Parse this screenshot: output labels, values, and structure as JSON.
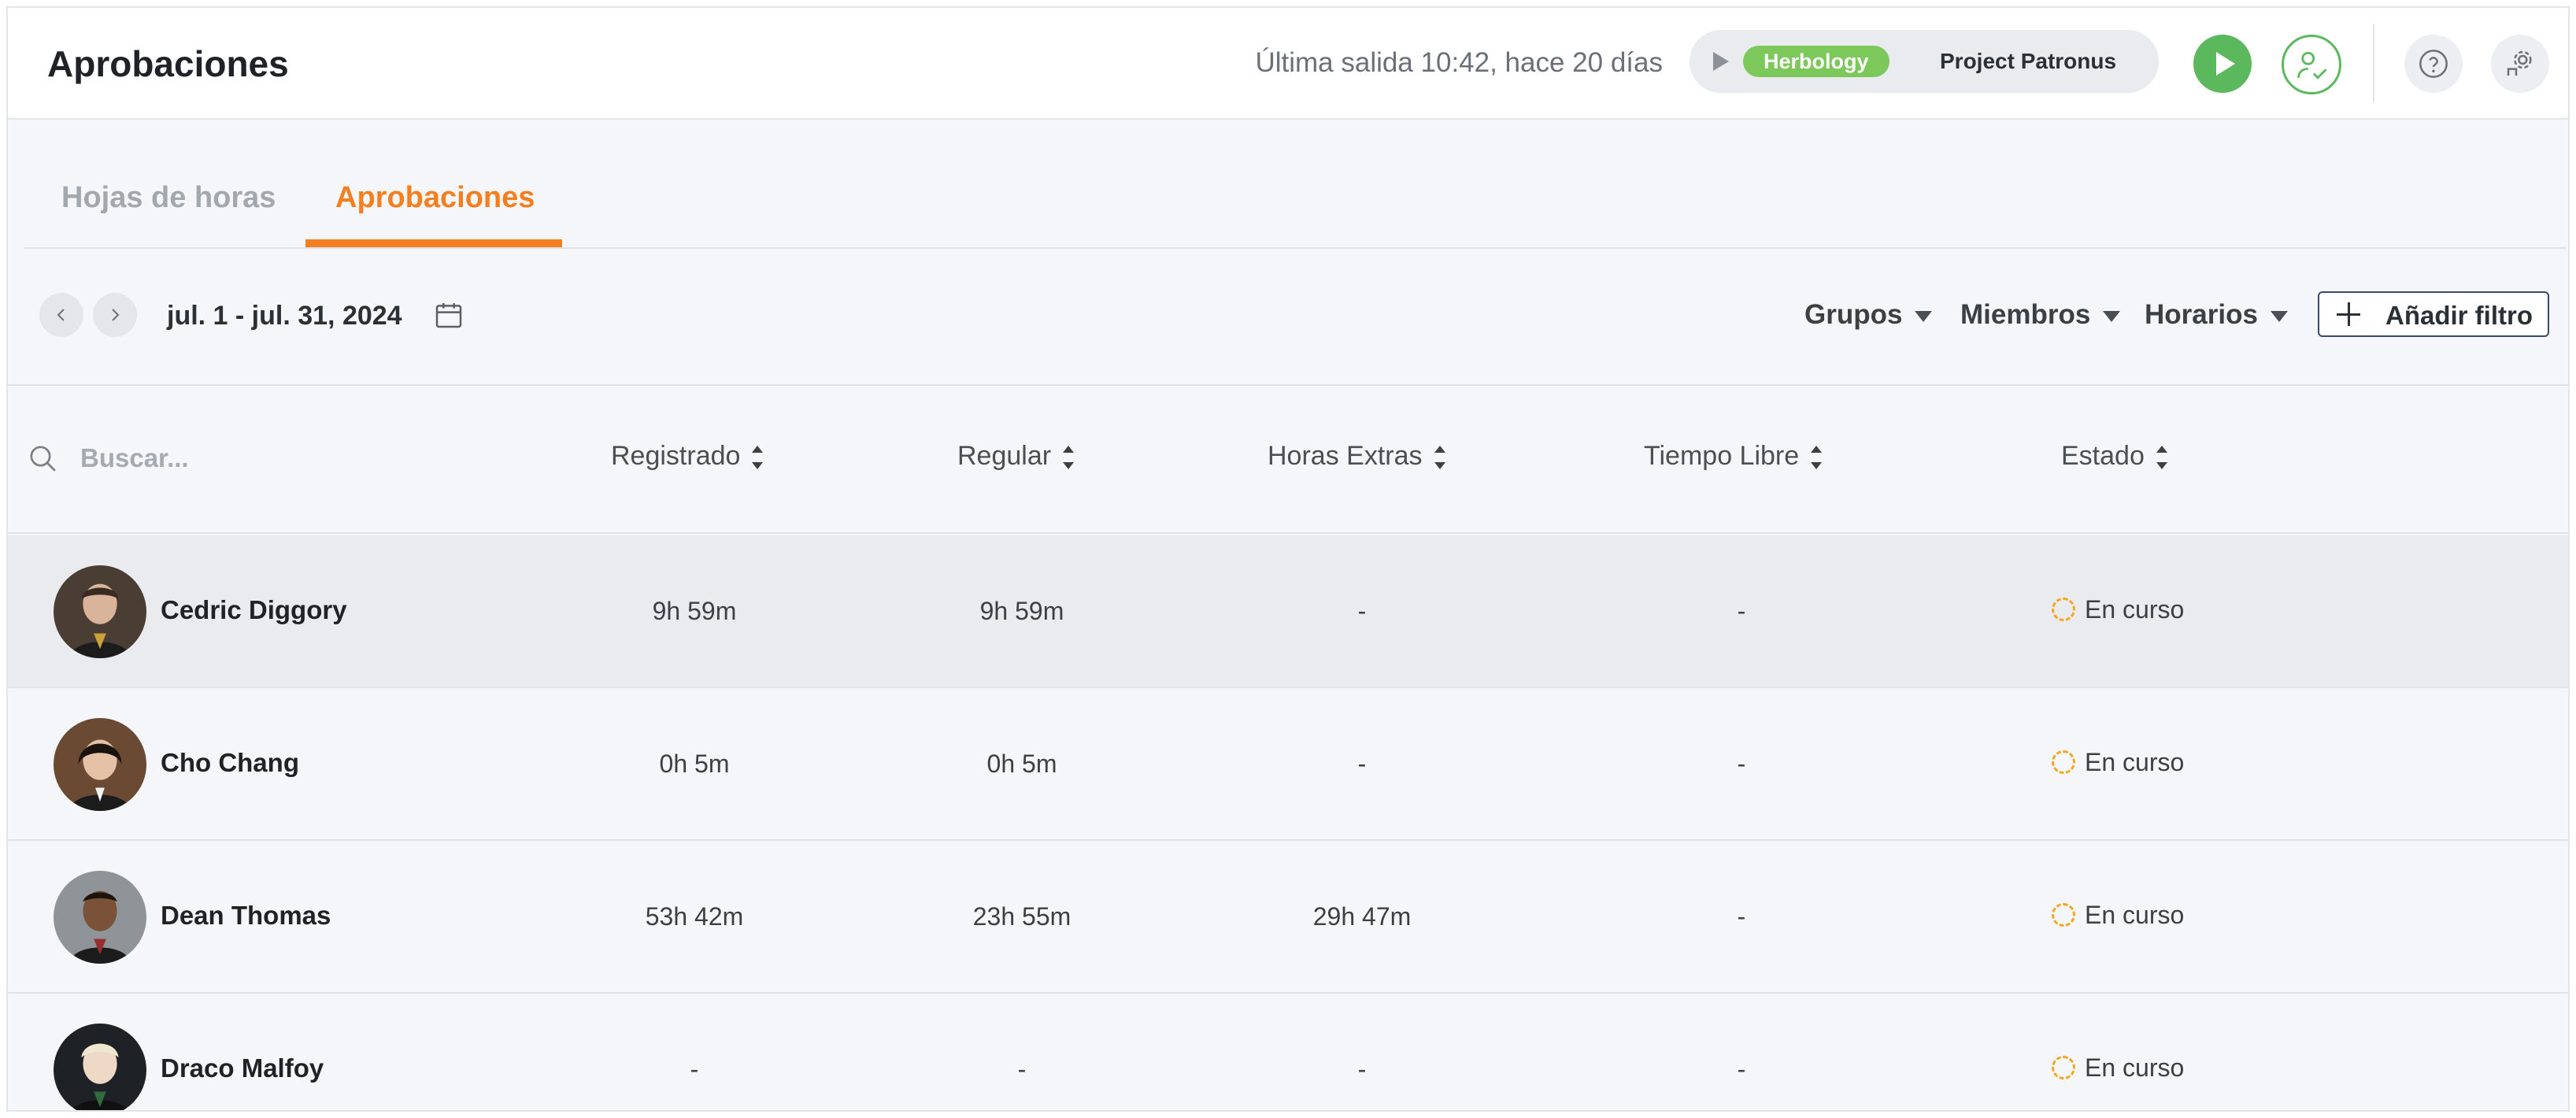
{
  "header": {
    "title": "Aprobaciones",
    "last_out": "Última salida 10:42, hace 20 días",
    "timer": {
      "project_tag": "Herbology",
      "project_name": "Project Patronus",
      "tag_color": "#7cc85a"
    },
    "icons": [
      "play-icon",
      "user-check-icon",
      "help-icon",
      "settings-icon"
    ]
  },
  "tabs": [
    {
      "label": "Hojas de horas",
      "active": false
    },
    {
      "label": "Aprobaciones",
      "active": true
    }
  ],
  "accent_color": "#f47f20",
  "toolbar": {
    "date_range": "jul. 1 - jul. 31, 2024",
    "filters": [
      "Grupos",
      "Miembros",
      "Horarios"
    ],
    "add_filter_label": "Añadir filtro"
  },
  "table": {
    "search_placeholder": "Buscar...",
    "columns": [
      "Registrado",
      "Regular",
      "Horas Extras",
      "Tiempo Libre",
      "Estado"
    ],
    "rows": [
      {
        "name": "Cedric Diggory",
        "registered": "9h 59m",
        "regular": "9h 59m",
        "overtime": "-",
        "time_off": "-",
        "status": "En curso"
      },
      {
        "name": "Cho Chang",
        "registered": "0h 5m",
        "regular": "0h 5m",
        "overtime": "-",
        "time_off": "-",
        "status": "En curso"
      },
      {
        "name": "Dean Thomas",
        "registered": "53h 42m",
        "regular": "23h 55m",
        "overtime": "29h 47m",
        "time_off": "-",
        "status": "En curso"
      },
      {
        "name": "Draco Malfoy",
        "registered": "-",
        "regular": "-",
        "overtime": "-",
        "time_off": "-",
        "status": "En curso"
      }
    ],
    "status_color": "#f5a623"
  }
}
